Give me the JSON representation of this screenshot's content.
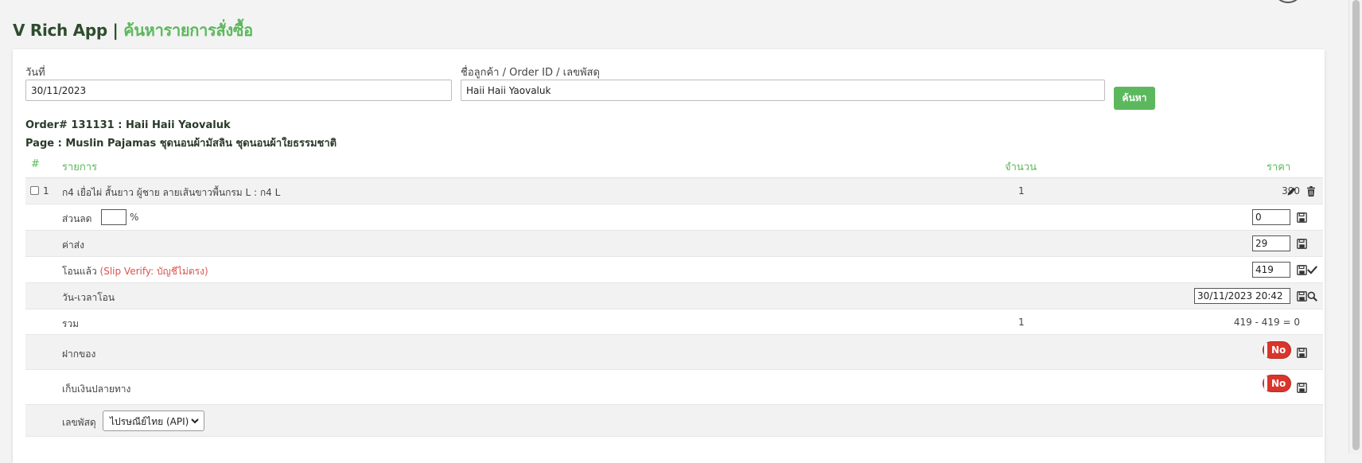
{
  "header": {
    "app_name": "V Rich App",
    "separator": "|",
    "page_title": "ค้นหารายการสั่งซื้อ"
  },
  "search": {
    "date_label": "วันที่",
    "date_value": "30/11/2023",
    "query_label": "ชื่อลูกค้า / Order ID / เลขพัสดุ",
    "query_value": "Haii Haii Yaovaluk",
    "button_label": "ค้นหา"
  },
  "order": {
    "title": "Order# 131131 : Haii Haii Yaovaluk",
    "page": "Page : Muslin Pajamas ชุดนอนผ้ามัสลิน ชุดนอนผ้าใยธรรมชาติ"
  },
  "table": {
    "headers": {
      "index": "#",
      "item": "รายการ",
      "qty": "จำนวน",
      "price": "ราคา"
    },
    "item_row": {
      "index": "1",
      "name": "ก4 เยื่อไผ่ สั้นยาว ผู้ชาย ลายเส้นขาวพื้นกรม L : ก4 L",
      "qty": "1",
      "price": "390"
    },
    "discount": {
      "label": "ส่วนลด",
      "percent_value": "",
      "percent_sign": "%",
      "amount": "0"
    },
    "shipping": {
      "label": "ค่าส่ง",
      "amount": "29"
    },
    "transferred": {
      "label": "โอนแล้ว",
      "note": "(Slip Verify: บัญชีไม่ตรง)",
      "amount": "419"
    },
    "transfer_time": {
      "label": "วัน-เวลาโอน",
      "value": "30/11/2023 20:42"
    },
    "total": {
      "label": "รวม",
      "qty": "1",
      "formula": "419 - 419 = 0"
    },
    "deposit": {
      "label": "ฝากของ",
      "toggle": "No"
    },
    "cod": {
      "label": "เก็บเงินปลายทาง",
      "toggle": "No"
    },
    "tracking": {
      "label": "เลขพัสดุ",
      "carrier": "ไปรษณีย์ไทย (API)"
    }
  },
  "colors": {
    "accent": "#5cb85c",
    "danger": "#d9534f",
    "toggle_off": "#d9352c"
  },
  "icons": {
    "edit": "pencil-icon",
    "delete": "trash-icon",
    "save": "floppy-disk-icon",
    "verify": "check-icon",
    "search": "search-icon",
    "dropdown": "chevron-down-icon"
  }
}
